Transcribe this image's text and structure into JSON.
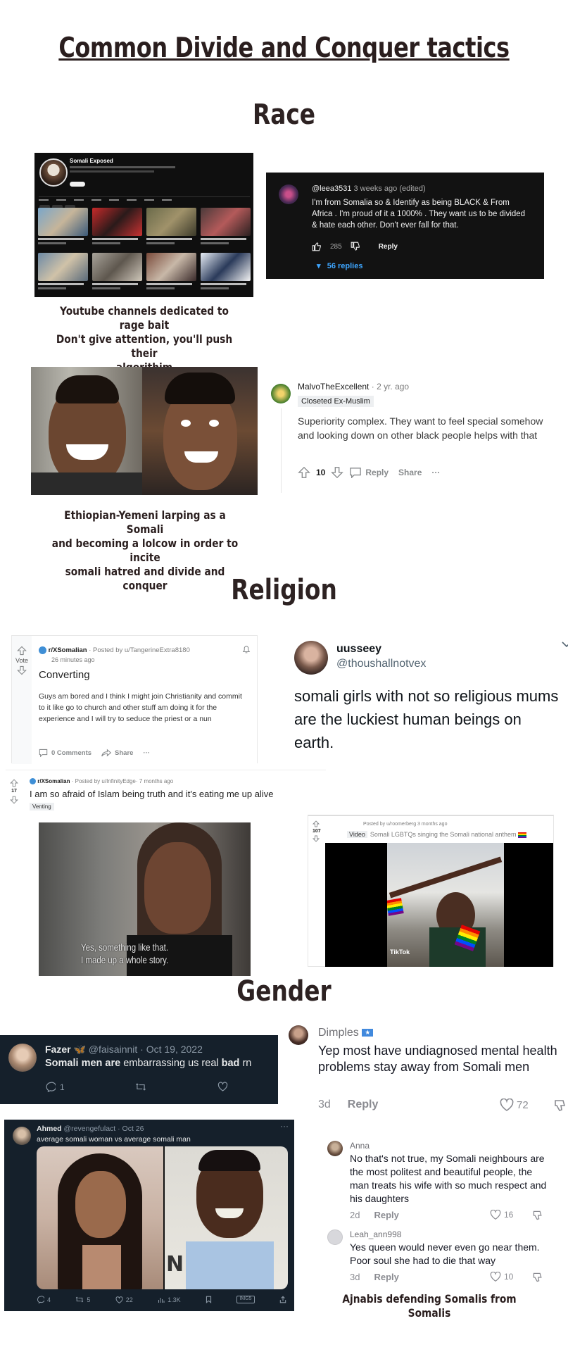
{
  "page": {
    "title": "Common Divide and Conquer tactics",
    "sections": {
      "race": "Race",
      "religion": "Religion",
      "gender": "Gender"
    },
    "captions": {
      "youtube": [
        "Youtube channels dedicated to rage bait",
        "Don't give attention, you'll push their",
        "algorithim"
      ],
      "larping": [
        "Ethiopian-Yemeni larping as a Somali",
        "and becoming a lolcow in order to incite",
        "somali hatred and divide and conquer"
      ],
      "ajnabis": "Ajnabis defending Somalis from Somalis"
    }
  },
  "yt_channel": {
    "name": "Somali Exposed"
  },
  "yt_comment": {
    "user": "@leea3531",
    "time": "3 weeks ago (edited)",
    "text": "I'm from Somalia so & Identify as being BLACK & From Africa . I'm proud of it a 1000% . They want us to be divided & hate each other. Don't ever fall for that.",
    "likes": "285",
    "reply_label": "Reply",
    "replies": "56 replies"
  },
  "reddit_comment": {
    "user": "MalvoTheExcellent",
    "time": "· 2 yr. ago",
    "flair": "Closeted Ex-Muslim",
    "text": "Superiority complex. They want to feel special somehow and looking down on other black people helps with that",
    "votes": "10",
    "reply_label": "Reply",
    "share_label": "Share",
    "more": "···"
  },
  "reddit_post": {
    "subreddit": "r/XSomalian",
    "posted_by": "· Posted by u/TangerineExtra8180",
    "time": "26 minutes ago",
    "vote_label": "Vote",
    "title": "Converting",
    "body": "Guys am bored and I think I might join Christianity and commit to it like go to church and other stuff am doing it for the experience and I will try to seduce the priest or a nun",
    "comments": "0 Comments",
    "share": "Share",
    "more": "···"
  },
  "tweet_uussey": {
    "name": "uusseey",
    "handle": "@thoushallnotvex",
    "text": "somali girls with not so religious mums are the luckiest human beings on earth."
  },
  "reddit_post2": {
    "subreddit": "r/XSomalian",
    "posted_by": "· Posted by u/InfinityEdge· 7 months ago",
    "votes": "17",
    "title": "I am so afraid of Islam being truth and it's eating me up alive",
    "flair": "Venting"
  },
  "video_still": {
    "subtitle_1": "Yes, something like that.",
    "subtitle_2": "I made up a whole story."
  },
  "reddit_video": {
    "posted_by": "Posted by u/roomerberg 3 months ago",
    "votes": "107",
    "tag": "Video",
    "title": "Somali LGBTQs singing the Somali national anthem",
    "watermark": "TikTok"
  },
  "tweet_fazer": {
    "name": "Fazer",
    "handle": "@faisainnit · Oct 19, 2022",
    "text_parts": [
      "Somali men are",
      " embarrassing us real ",
      "bad",
      " rn"
    ],
    "replies": "1"
  },
  "tweet_ahmed": {
    "name": "Ahmed",
    "handle": "@revengefulact · Oct 26",
    "text": "average somali woman vs average somali man",
    "more": "···",
    "replies": "4",
    "retweets": "5",
    "likes": "22",
    "views": "1.3K",
    "badge": "IMG5"
  },
  "tiktok": {
    "c1": {
      "name": "Dimples",
      "text": "Yep most have undiagnosed mental health problems stay away from Somali men",
      "time": "3d",
      "reply": "Reply",
      "likes": "72"
    },
    "c2": {
      "name": "Anna",
      "text": "No that's not true, my Somali neighbours are the most politest and beautiful people, the man treats his wife with so much respect and his daughters",
      "time": "2d",
      "reply": "Reply",
      "likes": "16"
    },
    "c3": {
      "name": "Leah_ann998",
      "text": "Yes queen would never even go near them. Poor soul she had to die that way",
      "time": "3d",
      "reply": "Reply",
      "likes": "10"
    }
  },
  "colors": {
    "youtube_bg": "#0f0f0f",
    "twitter_dim_bg": "#15202b",
    "link_blue": "#3ea6ff",
    "title_text": "#2a1e1e"
  }
}
